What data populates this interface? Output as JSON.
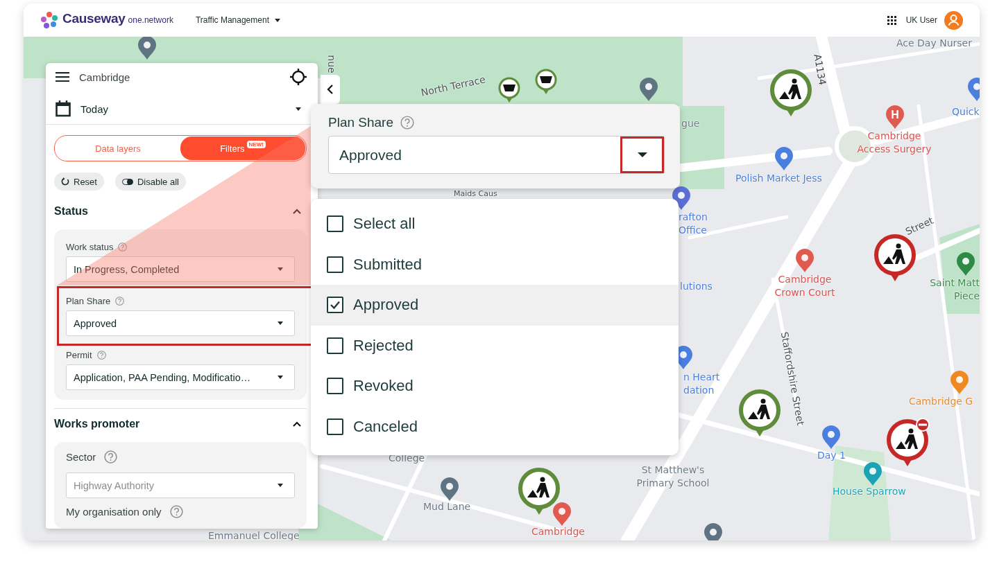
{
  "header": {
    "brand": "Causeway",
    "brand_suffix": "one.network",
    "module_menu": "Traffic Management",
    "user": "UK User"
  },
  "panel": {
    "location": "Cambridge",
    "date": "Today",
    "tabs": [
      {
        "label": "Data layers",
        "selected": false
      },
      {
        "label": "Filters",
        "selected": true,
        "badge": "NEW!"
      }
    ],
    "actions": [
      {
        "kind": "reset",
        "label": "Reset"
      },
      {
        "kind": "disable",
        "label": "Disable all"
      }
    ],
    "sections": [
      {
        "title": "Status",
        "expanded": true,
        "fields": [
          {
            "label": "Work status",
            "value": "In Progress, Completed",
            "highlighted": false
          },
          {
            "label": "Plan Share",
            "value": "Approved",
            "highlighted": true
          },
          {
            "label": "Permit",
            "value": "Application, PAA Pending, Modificatio…",
            "highlighted": false
          }
        ]
      },
      {
        "title": "Works promoter",
        "expanded": true,
        "fields": [
          {
            "label": "Sector",
            "placeholder": "Highway Authority",
            "highlighted": false
          },
          {
            "label": "My organisation only",
            "highlighted": false
          }
        ]
      }
    ]
  },
  "zoom_popup": {
    "label": "Plan Share",
    "value": "Approved",
    "caret_highlighted": true,
    "options": [
      {
        "label": "Select all",
        "checked": false,
        "selected": false
      },
      {
        "label": "Submitted",
        "checked": false,
        "selected": false
      },
      {
        "label": "Approved",
        "checked": true,
        "selected": true
      },
      {
        "label": "Rejected",
        "checked": false,
        "selected": false
      },
      {
        "label": "Revoked",
        "checked": false,
        "selected": false
      },
      {
        "label": "Canceled",
        "checked": false,
        "selected": false
      }
    ]
  },
  "map": {
    "labels": [
      {
        "lines": [
          "Ace Day Nurser"
        ],
        "color": "#6b7a86"
      },
      {
        "lines": [
          "A1134"
        ],
        "color": "#3a3f44"
      },
      {
        "lines": [
          "North Terrace"
        ],
        "color": "#4a5055"
      },
      {
        "lines": [
          "Quick"
        ],
        "color": "#4a7fe0"
      },
      {
        "lines": [
          "Cambridge",
          "Access Surgery"
        ],
        "color": "#d9534f"
      },
      {
        "lines": [
          "Polish Market Jess"
        ],
        "color": "#4a7fe0"
      },
      {
        "lines": [
          "gue"
        ],
        "color": "#6b7a86"
      },
      {
        "lines": [
          "rafton",
          "Office"
        ],
        "color": "#4a7fe0"
      },
      {
        "lines": [
          "lutions"
        ],
        "color": "#4a7fe0"
      },
      {
        "lines": [
          "Cambridge",
          "Crown Court"
        ],
        "color": "#d9534f"
      },
      {
        "lines": [
          "Saint Matt",
          "Piece"
        ],
        "color": "#3a8a4a"
      },
      {
        "lines": [
          "Street"
        ],
        "color": "#4a5055"
      },
      {
        "lines": [
          "Staffordshire Street"
        ],
        "color": "#4a5055"
      },
      {
        "lines": [
          "n Heart",
          "dation"
        ],
        "color": "#4a7fe0"
      },
      {
        "lines": [
          "Cambridge G"
        ],
        "color": "#e8892a"
      },
      {
        "lines": [
          "Day 1"
        ],
        "color": "#4a7fe0"
      },
      {
        "lines": [
          "House Sparrow"
        ],
        "color": "#1aa3b5"
      },
      {
        "lines": [
          "St Matthew's",
          "Primary School"
        ],
        "color": "#6b7a86"
      },
      {
        "lines": [
          "College"
        ],
        "color": "#6b7a86"
      },
      {
        "lines": [
          "Mud Lane"
        ],
        "color": "#6b7a86"
      },
      {
        "lines": [
          "Cambridge"
        ],
        "color": "#d9534f"
      },
      {
        "lines": [
          "Emmanuel College"
        ],
        "color": "#6b7a86"
      },
      {
        "lines": [
          "nue"
        ],
        "color": "#4a5055"
      },
      {
        "lines": [
          "Maids Caus"
        ],
        "color": "#4a5055"
      }
    ],
    "pins": [
      {
        "kind": "works",
        "color": "#5e8c3a",
        "no_entry": false
      },
      {
        "kind": "works",
        "color": "#c62828",
        "no_entry": false
      },
      {
        "kind": "works",
        "color": "#5e8c3a",
        "no_entry": false
      },
      {
        "kind": "works",
        "color": "#c62828",
        "no_entry": true
      },
      {
        "kind": "works",
        "color": "#5e8c3a",
        "no_entry": false
      },
      {
        "kind": "bowl",
        "color": "#5e8c3a"
      },
      {
        "kind": "bowl",
        "color": "#5e8c3a"
      },
      {
        "kind": "poi",
        "color": "#5f7482"
      },
      {
        "kind": "poi",
        "color": "#5f7482"
      },
      {
        "kind": "poi",
        "color": "#4a7fe0"
      },
      {
        "kind": "poi",
        "color": "#e05a50",
        "label": "H"
      },
      {
        "kind": "poi",
        "color": "#4a7fe0"
      },
      {
        "kind": "poi",
        "color": "#5b6fd6"
      },
      {
        "kind": "poi",
        "color": "#e05a50"
      },
      {
        "kind": "poi",
        "color": "#2e8b45"
      },
      {
        "kind": "poi",
        "color": "#4a7fe0"
      },
      {
        "kind": "poi",
        "color": "#ef8a22"
      },
      {
        "kind": "poi",
        "color": "#4a7fe0"
      },
      {
        "kind": "poi",
        "color": "#1aa3b5"
      },
      {
        "kind": "poi",
        "color": "#5f7482"
      },
      {
        "kind": "poi",
        "color": "#e05a50"
      },
      {
        "kind": "poi",
        "color": "#5f7482"
      }
    ]
  }
}
